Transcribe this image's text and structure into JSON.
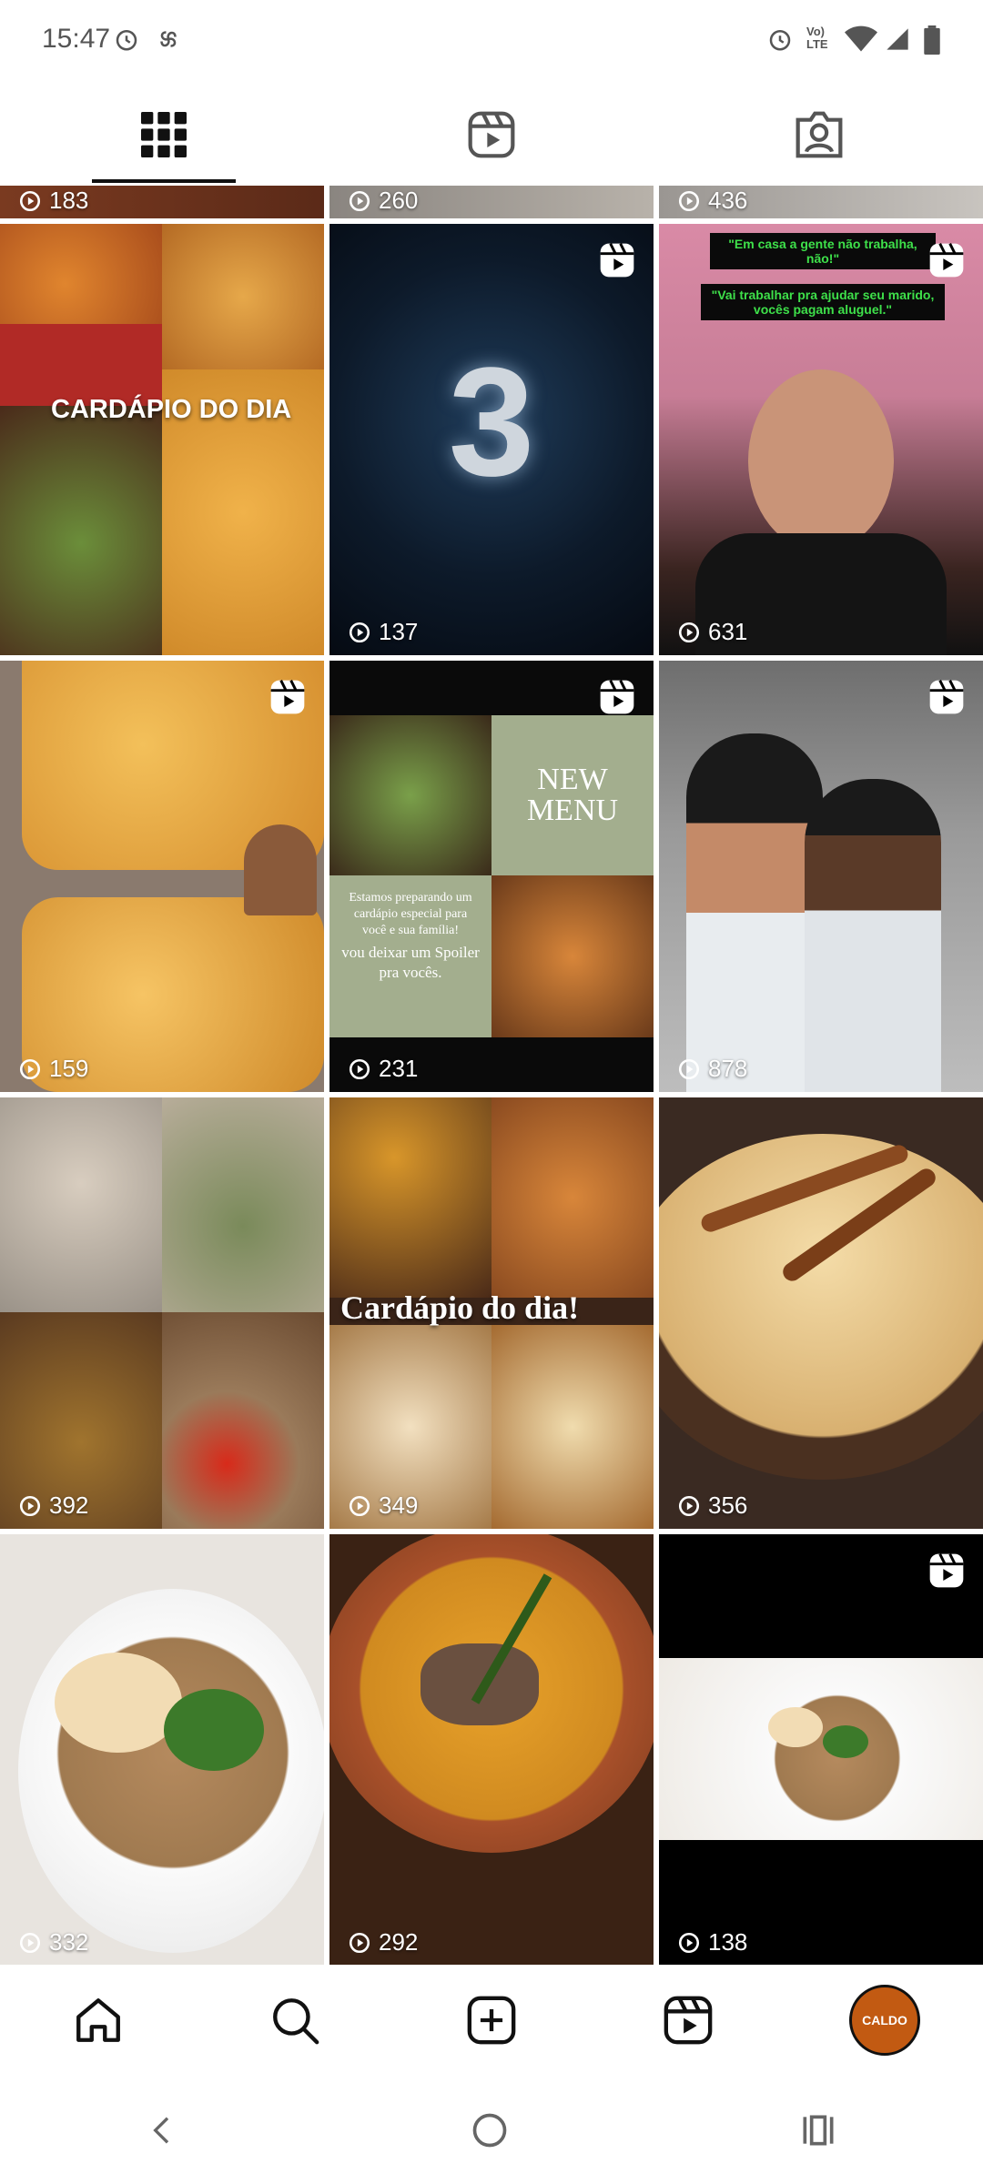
{
  "status": {
    "time": "15:47",
    "lte_label_top": "Vo)",
    "lte_label_bottom": "LTE"
  },
  "tabs": [
    {
      "name": "grid",
      "icon": "grid-icon",
      "active": true
    },
    {
      "name": "reels",
      "icon": "reels-icon",
      "active": false
    },
    {
      "name": "tagged",
      "icon": "tagged-icon",
      "active": false
    }
  ],
  "partial_row": [
    {
      "views": "183"
    },
    {
      "views": "260"
    },
    {
      "views": "436"
    }
  ],
  "tiles": [
    {
      "views": "",
      "reel": false,
      "overlay": "CARDÁPIO DO DIA"
    },
    {
      "views": "137",
      "reel": true,
      "overlay": "3"
    },
    {
      "views": "631",
      "reel": true,
      "overlay_top": "\"Em casa a gente não trabalha, não!\"",
      "overlay_bottom": "\"Vai trabalhar pra ajudar seu marido, vocês pagam aluguel.\""
    },
    {
      "views": "159",
      "reel": true
    },
    {
      "views": "231",
      "reel": true,
      "menu_title_1": "NEW",
      "menu_title_2": "MENU",
      "menu_text_1": "Estamos preparando um cardápio especial para você e sua família!",
      "menu_text_2": "vou deixar um Spoiler pra vocês."
    },
    {
      "views": "878",
      "reel": true
    },
    {
      "views": "392",
      "reel": false
    },
    {
      "views": "349",
      "reel": false,
      "overlay": "Cardápio do dia!"
    },
    {
      "views": "356",
      "reel": false
    },
    {
      "views": "332",
      "reel": false
    },
    {
      "views": "292",
      "reel": false
    },
    {
      "views": "138",
      "reel": true
    }
  ],
  "bottom_nav": [
    "home-icon",
    "search-icon",
    "create-icon",
    "reels-icon",
    "profile-avatar"
  ],
  "avatar_text": "CALDO",
  "colors": {
    "accent": "#111111",
    "avatar": "#c25a12",
    "menu_green": "#a3ae8e"
  }
}
